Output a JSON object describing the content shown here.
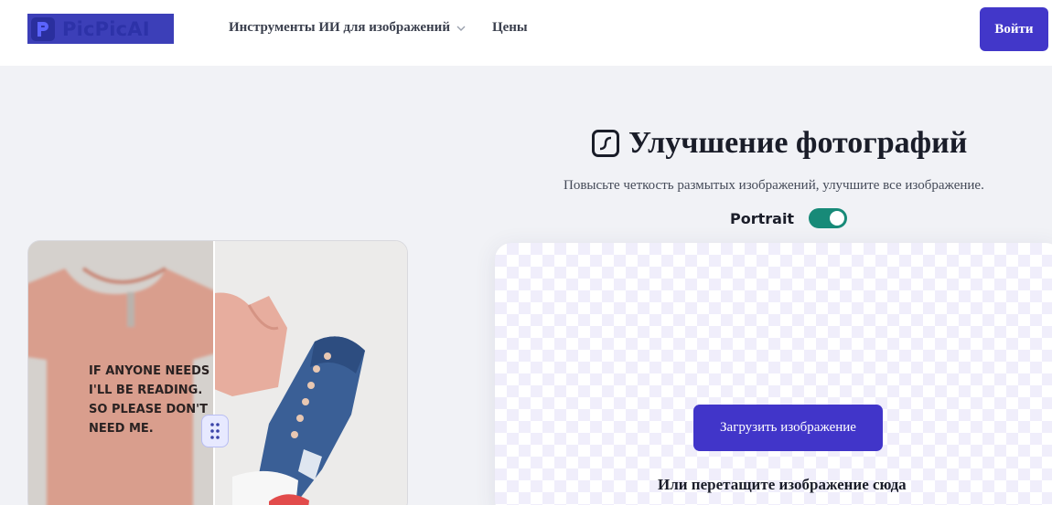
{
  "header": {
    "logo_text": "PicPicAI",
    "nav": [
      {
        "label": "Инструменты ИИ для изображений",
        "has_dropdown": true
      },
      {
        "label": "Цены",
        "has_dropdown": false
      }
    ],
    "login_label": "Войти"
  },
  "compare": {
    "shirt_text_lines": [
      "IF ANYONE NEEDS ME",
      "I'LL BE READING.",
      "SO PLEASE DON'T",
      "NEED ME."
    ]
  },
  "tool": {
    "title": "Улучшение фотографий",
    "subtitle": "Повысьте четкость размытых изображений, улучшите все изображение.",
    "portrait_label": "Portrait",
    "portrait_enabled": true,
    "upload_label": "Загрузить изображение",
    "drop_text": "Или перетащите изображение сюда"
  },
  "colors": {
    "accent": "#4237c9",
    "toggle_on": "#178a78",
    "page_bg": "#f1f2f6"
  },
  "icons": [
    "logo-mark-icon",
    "chevron-down-icon",
    "enhance-icon",
    "drag-handle-icon"
  ]
}
